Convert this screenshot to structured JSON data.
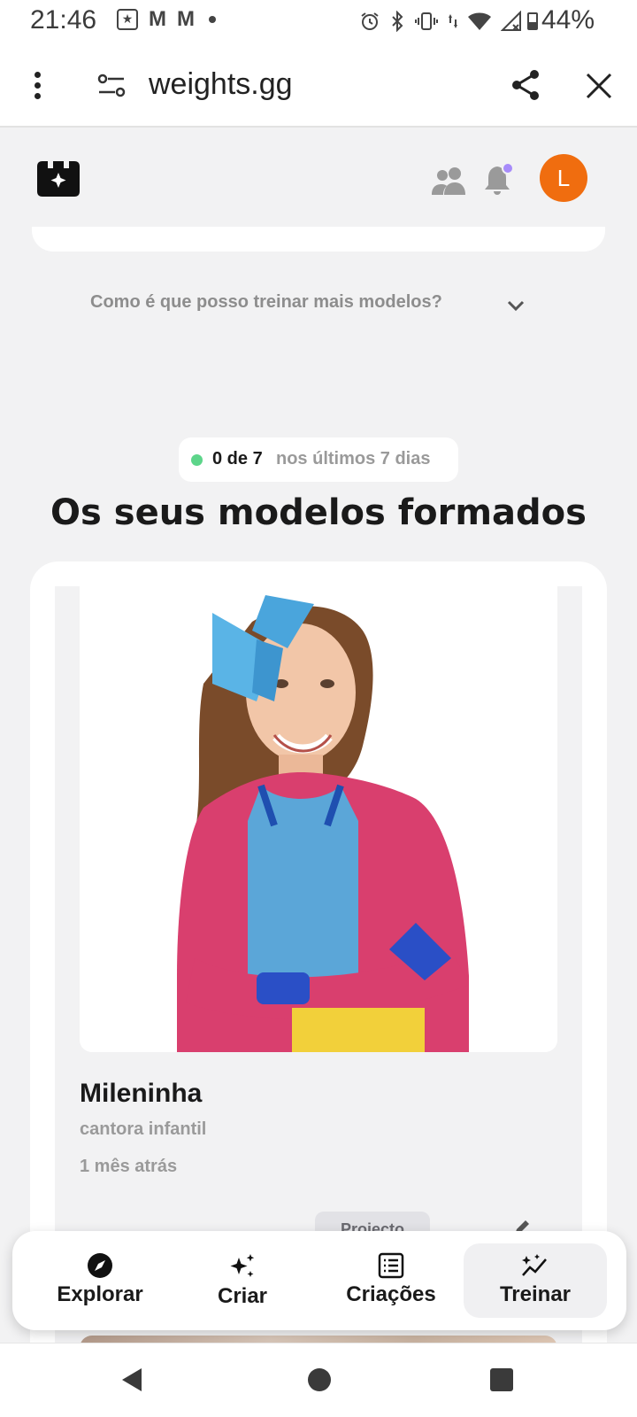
{
  "status_bar": {
    "time": "21:46",
    "battery": "44%",
    "notification_icons": [
      "star-notification-icon",
      "gmail-icon",
      "gmail-icon",
      "dot-icon"
    ],
    "system_icons": [
      "alarm-icon",
      "bluetooth-icon",
      "vibrate-icon",
      "data-icon",
      "wifi-icon",
      "signal-icon",
      "battery-icon"
    ]
  },
  "browser": {
    "url": "weights.gg"
  },
  "header": {
    "avatar_letter": "L",
    "avatar_color": "#f06d0f",
    "notification_dot_color": "#a78bfa"
  },
  "faq": {
    "question": "Como é que posso treinar mais modelos?"
  },
  "usage": {
    "count": "0 de 7",
    "period": "nos últimos 7 dias",
    "dot_color": "#5dd58a"
  },
  "section": {
    "title": "Os seus modelos formados"
  },
  "model": {
    "name": "Mileninha",
    "description": "cantora infantil",
    "time_ago": "1 mês atrás",
    "tag": "Projecto",
    "more": "..."
  },
  "bottom_nav": {
    "items": [
      {
        "label": "Explorar",
        "icon": "compass-icon"
      },
      {
        "label": "Criar",
        "icon": "sparkles-icon"
      },
      {
        "label": "Criações",
        "icon": "list-icon"
      },
      {
        "label": "Treinar",
        "icon": "train-chart-icon",
        "active": true
      }
    ]
  }
}
